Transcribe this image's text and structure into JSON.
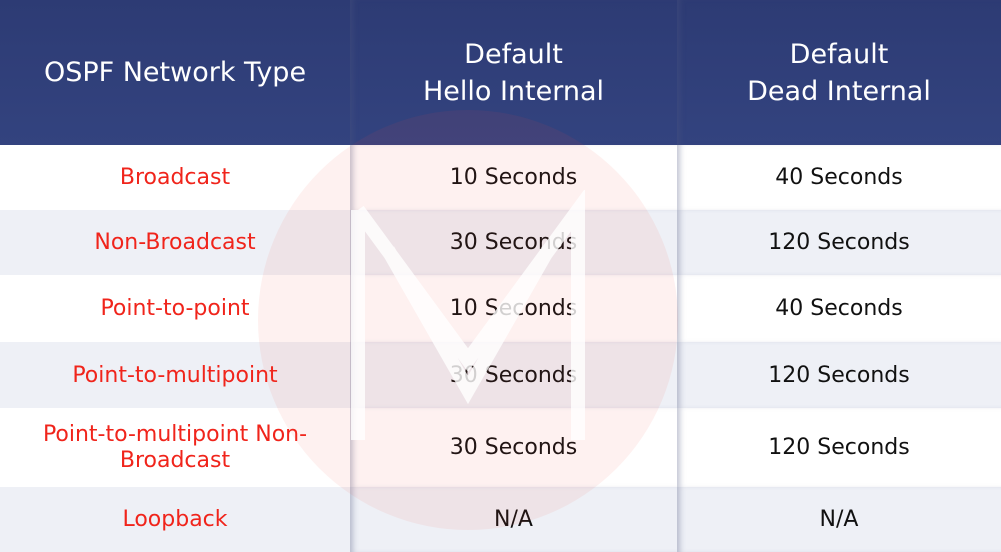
{
  "headers": [
    "OSPF Network Type",
    "Default\nHello Internal",
    "Default\nDead Internal"
  ],
  "rows": [
    {
      "type": "Broadcast",
      "hello": "10 Seconds",
      "dead": "40 Seconds"
    },
    {
      "type": "Non-Broadcast",
      "hello": "30 Seconds",
      "dead": "120 Seconds"
    },
    {
      "type": "Point-to-point",
      "hello": "10 Seconds",
      "dead": "40 Seconds"
    },
    {
      "type": "Point-to-multipoint",
      "hello": "30 Seconds",
      "dead": "120 Seconds"
    },
    {
      "type": "Point-to-multipoint Non-Broadcast",
      "hello": "30 Seconds",
      "dead": "120 Seconds"
    },
    {
      "type": "Loopback",
      "hello": "N/A",
      "dead": "N/A"
    }
  ],
  "colors": {
    "header": "#2f3f7a",
    "type_text": "#f0241b",
    "alt_row": "#eef0f6"
  }
}
